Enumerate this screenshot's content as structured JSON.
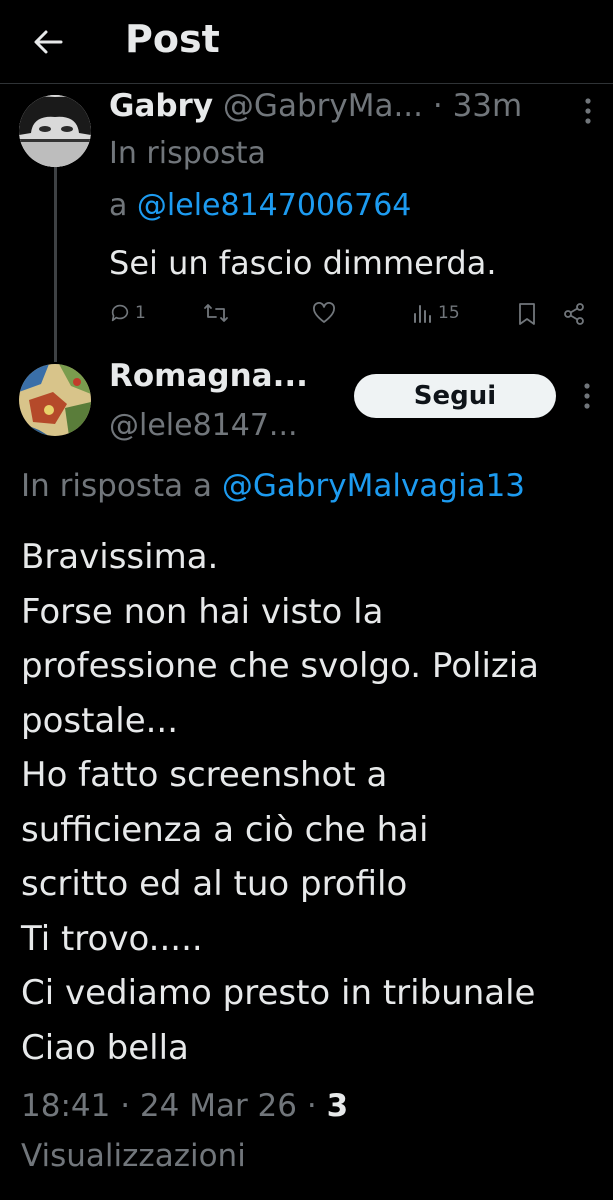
{
  "header": {
    "title": "Post",
    "back_icon": "arrow-left-icon"
  },
  "reply": {
    "author_name": "Gabry",
    "author_handle": "@GabryMa...",
    "separator": " · ",
    "time": "33m",
    "reply_to_prefix": "In risposta",
    "reply_to_a": "a ",
    "reply_to_handle": "@lele8147006764",
    "text": "Sei un fascio dimmerda.",
    "reply_count": "1",
    "views": "15"
  },
  "post": {
    "author_name": "Romagna...",
    "author_handle": "@lele8147...",
    "follow_label": "Segui",
    "reply_to_prefix": "In risposta a ",
    "reply_to_handle": "@GabryMalvagia13",
    "body_lines": [
      "Bravissima.",
      "Forse non hai visto la",
      "professione che svolgo. Polizia",
      "postale...",
      "Ho fatto screenshot a",
      "sufficienza a ciò che hai",
      "scritto ed al tuo profilo",
      "Ti trovo.....",
      "Ci vediamo presto in tribunale",
      "Ciao bella"
    ],
    "time": "18:41",
    "date": "24 Mar 26",
    "views_count": "3",
    "views_label": "Visualizzazioni"
  },
  "colors": {
    "background": "#000000",
    "text": "#e7e9ea",
    "secondary": "#71767b",
    "link": "#1d9bf0",
    "follow_bg": "#eff3f4"
  }
}
